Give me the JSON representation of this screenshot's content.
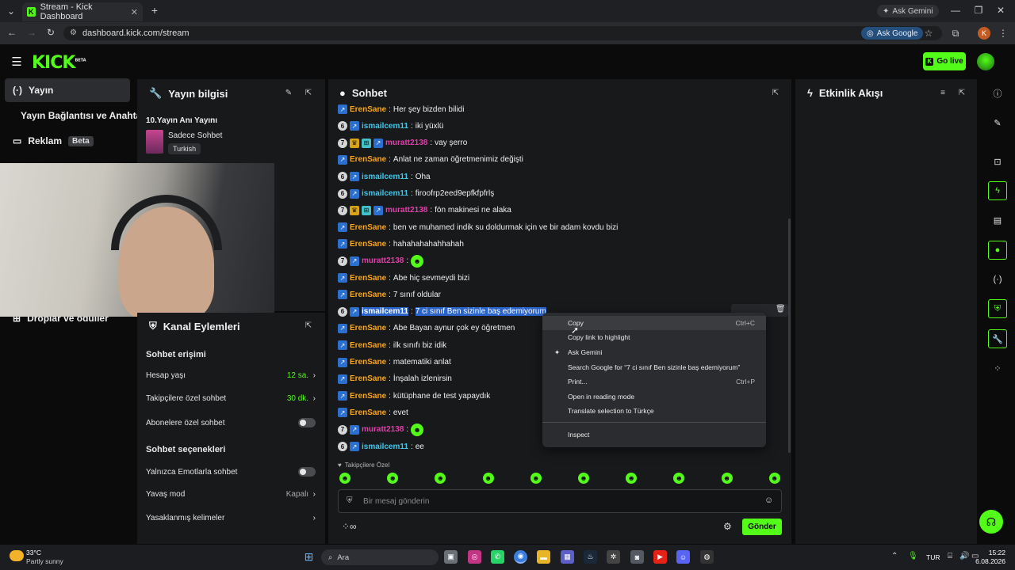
{
  "browser": {
    "tab_title": "Stream - Kick Dashboard",
    "ask_gemini": "Ask Gemini",
    "url": "dashboard.kick.com/stream",
    "ask_google": "Ask Google",
    "profile_letter": "K"
  },
  "header": {
    "logo": "KICK",
    "logo_beta": "BETA",
    "go_live": "Go live"
  },
  "nav": {
    "items": [
      {
        "label": "Yayın"
      },
      {
        "label": "Yayın Bağlantısı ve Anahtarı"
      },
      {
        "label": "Reklam",
        "badge": "Beta"
      },
      {
        "label": "Droplar ve ödüller"
      }
    ]
  },
  "stream_info": {
    "title": "Yayın bilgisi",
    "stream_title": "10.Yayın Anı Yayını",
    "category": "Sadece Sohbet",
    "language": "Turkish"
  },
  "channel_actions": {
    "title": "Kanal Eylemleri",
    "chat_access_title": "Sohbet erişimi",
    "account_age_label": "Hesap yaşı",
    "account_age_value": "12 sa.",
    "followers_only_label": "Takipçilere özel sohbet",
    "followers_only_value": "30 dk.",
    "subscribers_only_label": "Abonelere özel sohbet",
    "chat_options_title": "Sohbet seçenekleri",
    "emotes_only_label": "Yalnızca Emotlarla sohbet",
    "slow_mode_label": "Yavaş mod",
    "slow_mode_value": "Kapalı",
    "banned_words_label": "Yasaklanmış kelimeler"
  },
  "chat": {
    "title": "Sohbet",
    "messages": [
      {
        "badges": [
          "blue"
        ],
        "user": "ErenSane",
        "color": "orange",
        "text": "Her şey bizden bilidi"
      },
      {
        "badges": [
          "num6",
          "blue"
        ],
        "user": "ismailcem11",
        "color": "cyan",
        "text": "iki yüxlü"
      },
      {
        "badges": [
          "num7",
          "crown",
          "gift",
          "blue"
        ],
        "user": "muratt2138",
        "color": "pink",
        "text": "vay şerro"
      },
      {
        "badges": [
          "blue"
        ],
        "user": "ErenSane",
        "color": "orange",
        "text": "Anlat ne zaman öğretmenimiz değişti"
      },
      {
        "badges": [
          "num6",
          "blue"
        ],
        "user": "ismailcem11",
        "color": "cyan",
        "text": "Oha"
      },
      {
        "badges": [
          "num6",
          "blue"
        ],
        "user": "ismailcem11",
        "color": "cyan",
        "text": "firoofrp2eed9epfkfpfrlş"
      },
      {
        "badges": [
          "num7",
          "crown",
          "gift",
          "blue"
        ],
        "user": "muratt2138",
        "color": "pink",
        "text": "fön makinesi ne alaka"
      },
      {
        "badges": [
          "blue"
        ],
        "user": "ErenSane",
        "color": "orange",
        "text": "ben ve muhamed indik su doldurmak için ve bir adam kovdu bizi"
      },
      {
        "badges": [
          "blue"
        ],
        "user": "ErenSane",
        "color": "orange",
        "text": "hahahahahahhahah"
      },
      {
        "badges": [
          "num7",
          "blue"
        ],
        "user": "muratt2138",
        "color": "pink",
        "text": "",
        "emote": true
      },
      {
        "badges": [
          "blue"
        ],
        "user": "ErenSane",
        "color": "orange",
        "text": "Abe hiç sevmeydi bizi"
      },
      {
        "badges": [
          "blue"
        ],
        "user": "ErenSane",
        "color": "orange",
        "text": "7 sınıf oldular"
      },
      {
        "badges": [
          "num6",
          "blue"
        ],
        "user": "ismailcem11",
        "color": "cyan",
        "text": "7 ci sınıf Ben sizinle baş edemiyorum",
        "selected": true
      },
      {
        "badges": [
          "blue"
        ],
        "user": "ErenSane",
        "color": "orange",
        "text": "Abe Bayan aynur çok ey öğretmen"
      },
      {
        "badges": [
          "blue"
        ],
        "user": "ErenSane",
        "color": "orange",
        "text": "ilk sınıfı biz idik"
      },
      {
        "badges": [
          "blue"
        ],
        "user": "ErenSane",
        "color": "orange",
        "text": "matematiki anlat"
      },
      {
        "badges": [
          "blue"
        ],
        "user": "ErenSane",
        "color": "orange",
        "text": "İnşalah izlenirsin"
      },
      {
        "badges": [
          "blue"
        ],
        "user": "ErenSane",
        "color": "orange",
        "text": "kütüphane de test yapaydık"
      },
      {
        "badges": [
          "blue"
        ],
        "user": "ErenSane",
        "color": "orange",
        "text": "evet"
      },
      {
        "badges": [
          "num7",
          "blue"
        ],
        "user": "muratt2138",
        "color": "pink",
        "text": "",
        "emote": true
      },
      {
        "badges": [
          "num6",
          "blue"
        ],
        "user": "ismailcem11",
        "color": "cyan",
        "text": "ee"
      }
    ],
    "followers_only_label": "Takipçilere Özel",
    "input_placeholder": "Bir mesaj gönderin",
    "send_button": "Gönder"
  },
  "context_menu": {
    "items": [
      {
        "label": "Copy",
        "shortcut": "Ctrl+C"
      },
      {
        "label": "Copy link to highlight",
        "shortcut": ""
      },
      {
        "label": "Ask Gemini",
        "shortcut": ""
      },
      {
        "label": "Search Google for “7 ci sınıf Ben sizinle baş edemiyorum”",
        "shortcut": ""
      },
      {
        "label": "Print...",
        "shortcut": "Ctrl+P"
      },
      {
        "label": "Open in reading mode",
        "shortcut": ""
      },
      {
        "label": "Translate selection to Türkçe",
        "shortcut": ""
      },
      {
        "label": "Inspect",
        "shortcut": ""
      }
    ]
  },
  "activity_feed": {
    "title": "Etkinlik Akışı"
  },
  "taskbar": {
    "weather_temp": "33°C",
    "weather_desc": "Partly sunny",
    "search_label": "Ara",
    "lang": "TUR",
    "time": "15:22",
    "date": "6.08.2026"
  },
  "colors": {
    "accent": "#53fc18",
    "orange": "#f5a623",
    "cyan": "#3fc6e8",
    "pink": "#e13faa"
  }
}
